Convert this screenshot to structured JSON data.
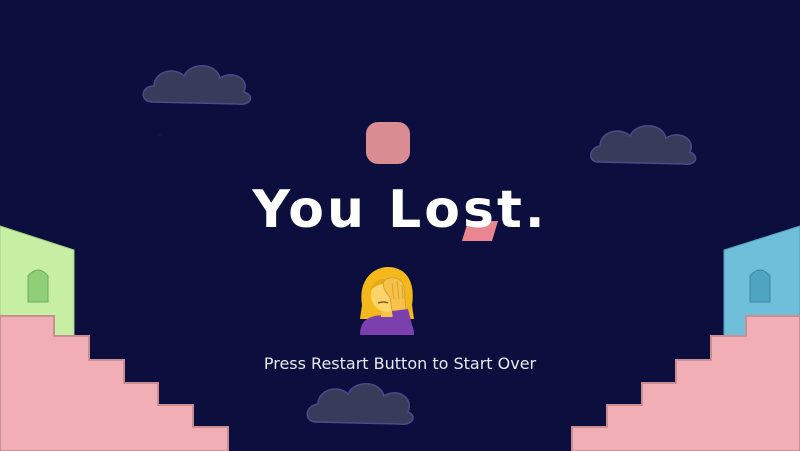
{
  "screen": {
    "title": "You Lost.",
    "message": "Press Restart Button to Start Over"
  },
  "colors": {
    "background": "#0c0f3d",
    "cloud": "#3a3d5c",
    "stairs": "#f1aeb4",
    "left_house": "#c7efa4",
    "right_house": "#6fbfda",
    "ball": "#d98d93"
  },
  "icons": {
    "emoji": "facepalm-woman-emoji"
  }
}
